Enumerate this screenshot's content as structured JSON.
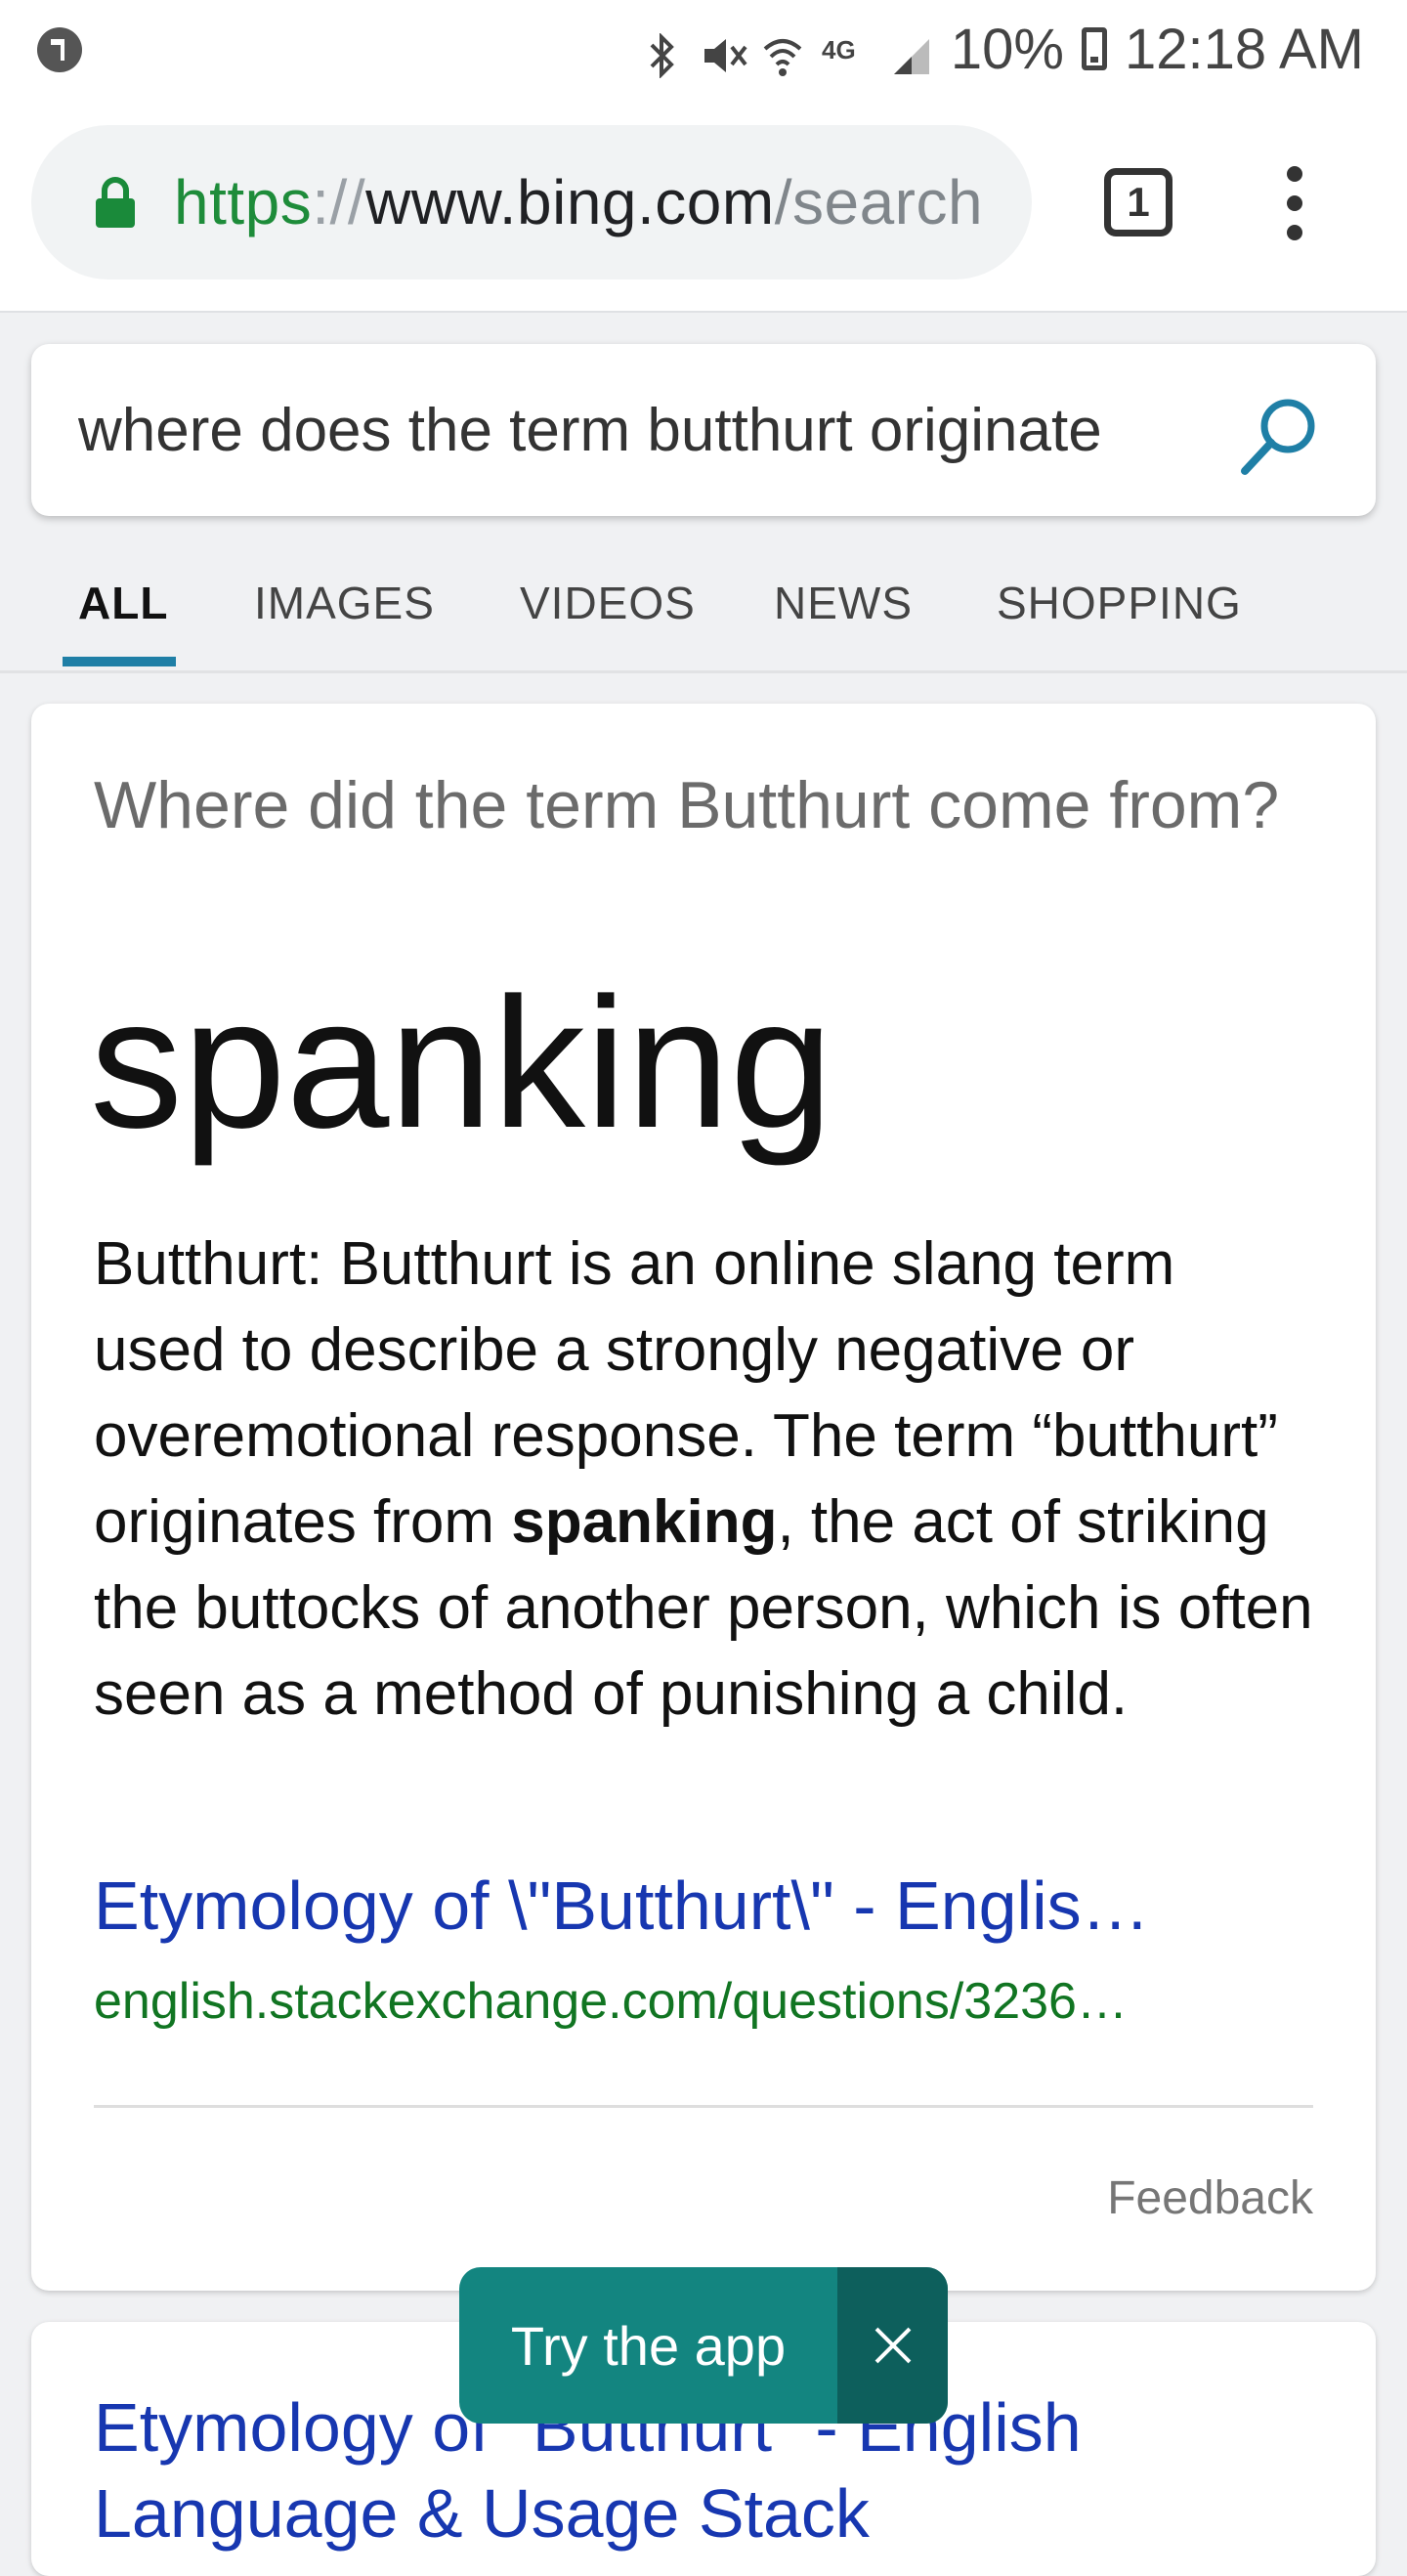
{
  "status_bar": {
    "battery": "10%",
    "time": "12:18 AM",
    "network": "4G"
  },
  "browser": {
    "url_scheme": "https",
    "url_separator": "://",
    "url_host": "www.bing.com",
    "url_path": "/search",
    "tab_count": "1"
  },
  "search": {
    "query": "where does the term butthurt originate"
  },
  "tabs": [
    {
      "label": "ALL",
      "active": true
    },
    {
      "label": "IMAGES",
      "active": false
    },
    {
      "label": "VIDEOS",
      "active": false
    },
    {
      "label": "NEWS",
      "active": false
    },
    {
      "label": "SHOPPING",
      "active": false
    }
  ],
  "answer": {
    "question": "Where did the term Butthurt come from?",
    "answer": "spanking",
    "desc_before": "Butthurt: Butthurt is an online slang term used to describe a strongly negative or overemotional response. The term “butthurt” originates from ",
    "desc_bold": "spanking",
    "desc_after": ", the act of striking the buttocks of another person, which is often seen as a method of punishing a child.",
    "source_title": "Etymology of \\\"Butthurt\\\" - Englis…",
    "source_url": "english.stackexchange.com/questions/3236…",
    "feedback": "Feedback"
  },
  "result2": {
    "title": "Etymology of \"Butthurt\" - English Language & Usage Stack"
  },
  "banner": {
    "label": "Try the app"
  },
  "colors": {
    "link": "#1737b0",
    "url_green": "#117522",
    "accent": "#1f7fa6",
    "banner": "#138580"
  }
}
